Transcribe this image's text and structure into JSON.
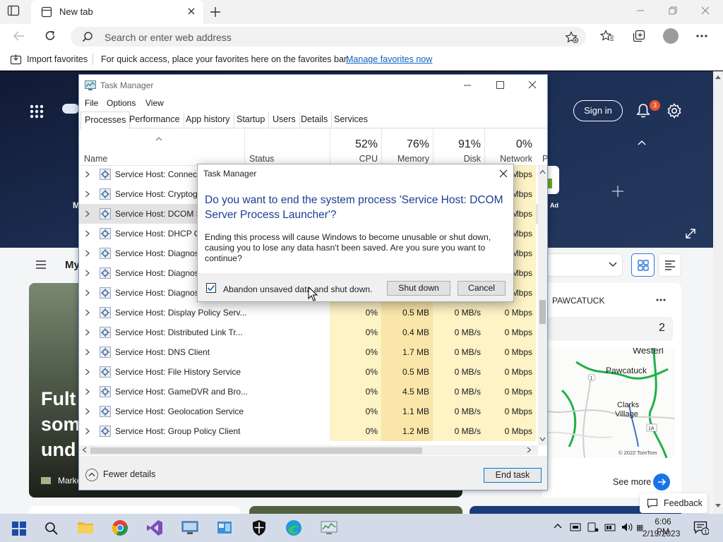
{
  "browser": {
    "tab_title": "New tab",
    "address_placeholder": "Search or enter web address",
    "favbar": {
      "import_label": "Import favorites",
      "tip": "For quick access, place your favorites here on the favorites bar.",
      "manage_link": "Manage favorites now"
    }
  },
  "ntp": {
    "hero_partial": "M",
    "signin": "Sign in",
    "notification_count": "3",
    "ad_label": "Ad",
    "feed_partial": "My",
    "news": {
      "title_partial": "Fult\nsom\nund",
      "source_partial": "Marke"
    },
    "weather": {
      "location": "PAWCATUCK",
      "count": "2",
      "map_labels": [
        "Westerl",
        "Pawcatuck",
        "Clarks\nVillage",
        "© 2022 TomTom",
        "1A",
        "1"
      ],
      "see_more": "See more"
    },
    "feedback": "Feedback"
  },
  "task_manager": {
    "title": "Task Manager",
    "menu": [
      "File",
      "Options",
      "View"
    ],
    "tabs": [
      "Processes",
      "Performance",
      "App history",
      "Startup",
      "Users",
      "Details",
      "Services"
    ],
    "active_tab": 0,
    "headers": {
      "name": "Name",
      "status": "Status",
      "cpu_pct": "52%",
      "cpu": "CPU",
      "mem_pct": "76%",
      "mem": "Memory",
      "disk_pct": "91%",
      "disk": "Disk",
      "net_pct": "0%",
      "net": "Network",
      "more": "P"
    },
    "rows": [
      {
        "name": "Service Host: Connect",
        "cpu": "",
        "mem": "",
        "disk": "",
        "net": "Mbps"
      },
      {
        "name": "Service Host: Cryptogr",
        "cpu": "",
        "mem": "",
        "disk": "",
        "net": "Mbps"
      },
      {
        "name": "Service Host: DCOM S",
        "cpu": "",
        "mem": "",
        "disk": "",
        "net": "Mbps",
        "selected": true
      },
      {
        "name": "Service Host: DHCP Cl",
        "cpu": "",
        "mem": "",
        "disk": "",
        "net": "Mbps"
      },
      {
        "name": "Service Host: Diagnost",
        "cpu": "",
        "mem": "",
        "disk": "",
        "net": "Mbps"
      },
      {
        "name": "Service Host: Diagnost",
        "cpu": "",
        "mem": "",
        "disk": "",
        "net": "Mbps"
      },
      {
        "name": "Service Host: Diagnost",
        "cpu": "",
        "mem": "",
        "disk": "",
        "net": "Mbps"
      },
      {
        "name": "Service Host: Display Policy Serv...",
        "cpu": "0%",
        "mem": "0.5 MB",
        "disk": "0 MB/s",
        "net": "0 Mbps"
      },
      {
        "name": "Service Host: Distributed Link Tr...",
        "cpu": "0%",
        "mem": "0.4 MB",
        "disk": "0 MB/s",
        "net": "0 Mbps"
      },
      {
        "name": "Service Host: DNS Client",
        "cpu": "0%",
        "mem": "1.7 MB",
        "disk": "0 MB/s",
        "net": "0 Mbps"
      },
      {
        "name": "Service Host: File History Service",
        "cpu": "0%",
        "mem": "0.5 MB",
        "disk": "0 MB/s",
        "net": "0 Mbps"
      },
      {
        "name": "Service Host: GameDVR and Bro...",
        "cpu": "0%",
        "mem": "4.5 MB",
        "disk": "0 MB/s",
        "net": "0 Mbps"
      },
      {
        "name": "Service Host: Geolocation Service",
        "cpu": "0%",
        "mem": "1.1 MB",
        "disk": "0 MB/s",
        "net": "0 Mbps"
      },
      {
        "name": "Service Host: Group Policy Client",
        "cpu": "0%",
        "mem": "1.2 MB",
        "disk": "0 MB/s",
        "net": "0 Mbps"
      }
    ],
    "footer": {
      "fewer_details": "Fewer details",
      "end_task": "End task"
    }
  },
  "dialog": {
    "title": "Task Manager",
    "heading": "Do you want to end the system process 'Service Host: DCOM Server Process Launcher'?",
    "body": "Ending this process will cause Windows to become unusable or shut down, causing you to lose any data hasn't been saved. Are you sure you want to continue?",
    "checkbox_label": "Abandon unsaved data and shut down.",
    "checkbox_checked": true,
    "shutdown": "Shut down",
    "cancel": "Cancel"
  },
  "taskbar": {
    "time": "6:06 PM",
    "date": "2/19/2023",
    "notification_count": "1",
    "apps": [
      "start-icon",
      "search-icon",
      "file-explorer-icon",
      "chrome-icon",
      "visual-studio-icon",
      "network-app-icon",
      "control-panel-icon",
      "security-icon",
      "edge-icon",
      "task-manager-icon"
    ]
  },
  "colors": {
    "accent": "#0078d7",
    "dialog_heading": "#1c3e94",
    "cpu_heat": "#fdf3c5",
    "mem_heat": "#f9e6a8"
  }
}
